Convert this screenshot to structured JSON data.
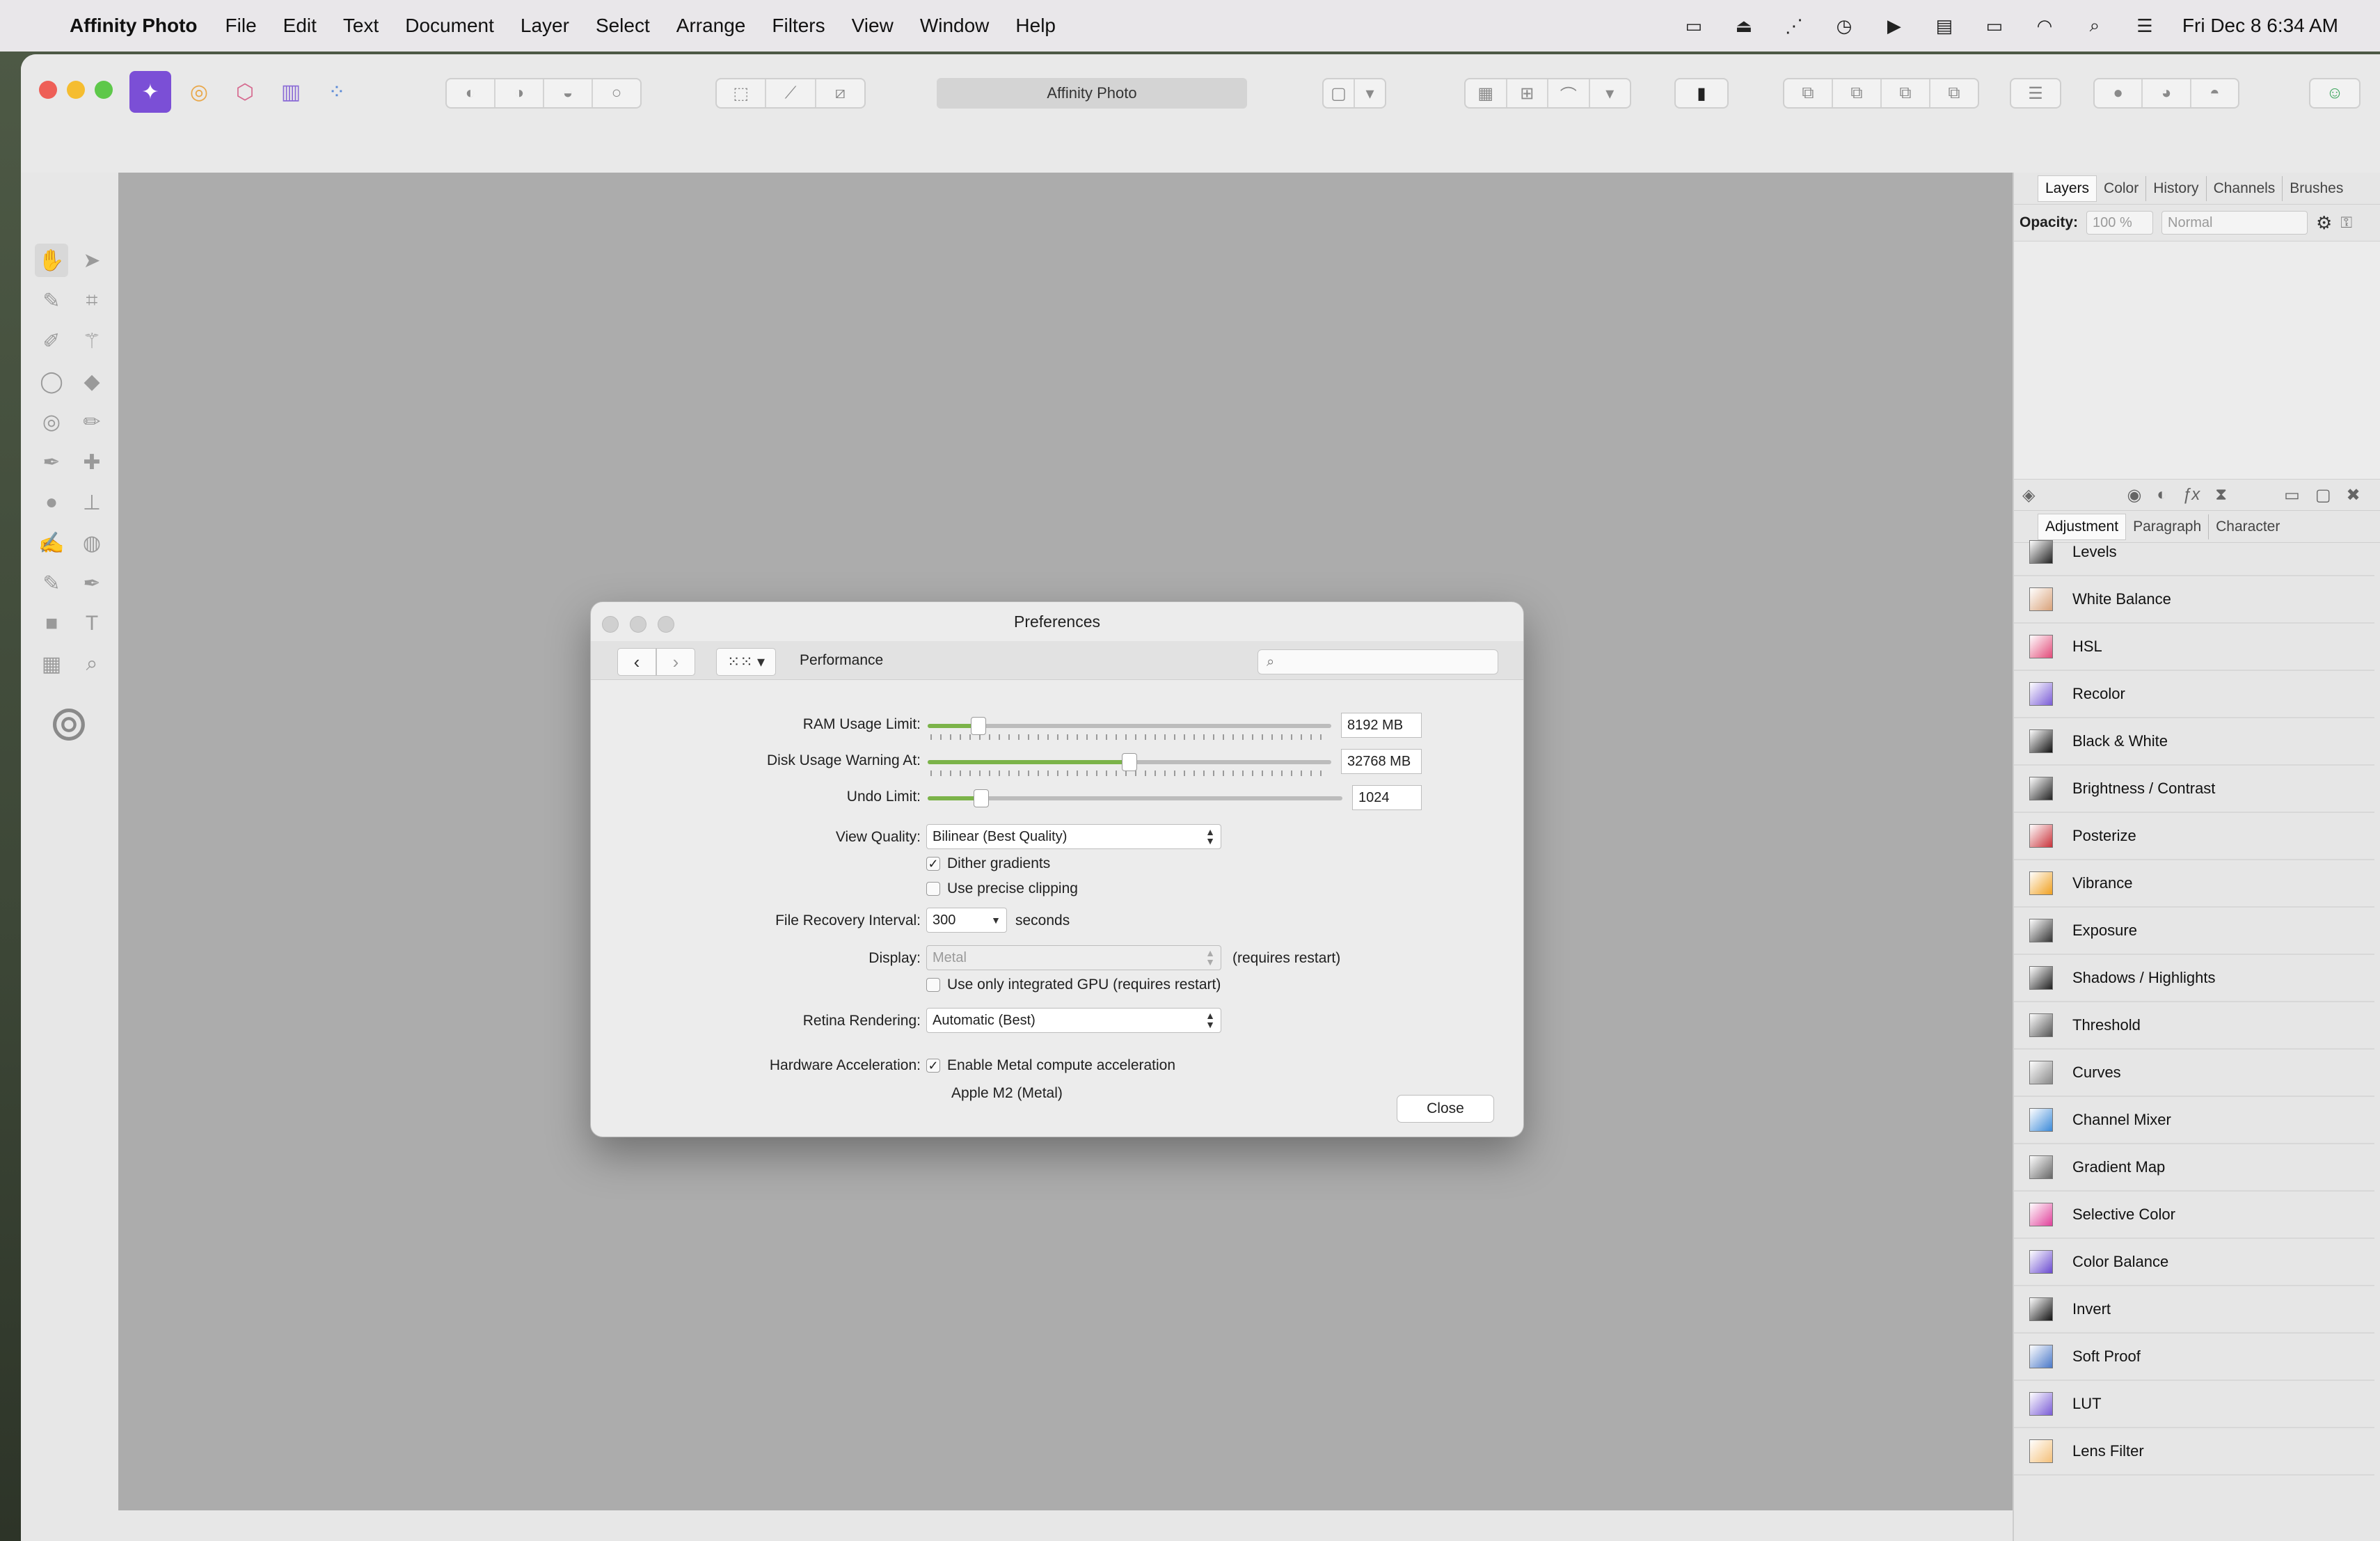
{
  "menubar": {
    "app_name": "Affinity Photo",
    "items": [
      "File",
      "Edit",
      "Text",
      "Document",
      "Layer",
      "Select",
      "Arrange",
      "Filters",
      "View",
      "Window",
      "Help"
    ],
    "clock": "Fri Dec 8  6:34 AM"
  },
  "toolbar": {
    "document_title": "Affinity Photo"
  },
  "panel": {
    "top_tabs": [
      "Layers",
      "Color",
      "History",
      "Channels",
      "Brushes"
    ],
    "opacity_label": "Opacity:",
    "opacity_value": "100 %",
    "blend_mode": "Normal",
    "bottom_tabs": [
      "Adjustment",
      "Paragraph",
      "Character"
    ],
    "adjustments": [
      {
        "label": "Levels",
        "icon": "levels-icon",
        "color": "#222222"
      },
      {
        "label": "White Balance",
        "icon": "white-balance-icon",
        "color": "#d9a27a"
      },
      {
        "label": "HSL",
        "icon": "hsl-icon",
        "color": "#e24b7a"
      },
      {
        "label": "Recolor",
        "icon": "recolor-icon",
        "color": "#7a5cd6"
      },
      {
        "label": "Black & White",
        "icon": "black-white-icon",
        "color": "#111111"
      },
      {
        "label": "Brightness / Contrast",
        "icon": "brightness-contrast-icon",
        "color": "#222222"
      },
      {
        "label": "Posterize",
        "icon": "posterize-icon",
        "color": "#c9323a"
      },
      {
        "label": "Vibrance",
        "icon": "vibrance-icon",
        "color": "#f0a020"
      },
      {
        "label": "Exposure",
        "icon": "exposure-icon",
        "color": "#333333"
      },
      {
        "label": "Shadows / Highlights",
        "icon": "shadows-highlights-icon",
        "color": "#1f1f1f"
      },
      {
        "label": "Threshold",
        "icon": "threshold-icon",
        "color": "#555555"
      },
      {
        "label": "Curves",
        "icon": "curves-icon",
        "color": "#888888"
      },
      {
        "label": "Channel Mixer",
        "icon": "channel-mixer-icon",
        "color": "#3b8ad9"
      },
      {
        "label": "Gradient Map",
        "icon": "gradient-map-icon",
        "color": "#666666"
      },
      {
        "label": "Selective Color",
        "icon": "selective-color-icon",
        "color": "#e0409a"
      },
      {
        "label": "Color Balance",
        "icon": "color-balance-icon",
        "color": "#6a4ad0"
      },
      {
        "label": "Invert",
        "icon": "invert-icon",
        "color": "#111111"
      },
      {
        "label": "Soft Proof",
        "icon": "soft-proof-icon",
        "color": "#4a78c8"
      },
      {
        "label": "LUT",
        "icon": "lut-icon",
        "color": "#7a5cd6"
      },
      {
        "label": "Lens Filter",
        "icon": "lens-filter-icon",
        "color": "#f4c07a"
      }
    ]
  },
  "dialog": {
    "title": "Preferences",
    "section": "Performance",
    "search_placeholder": "",
    "ram_label": "RAM Usage Limit:",
    "ram_value": "8192 MB",
    "ram_fraction": 0.125,
    "disk_label": "Disk Usage Warning At:",
    "disk_value": "32768 MB",
    "disk_fraction": 0.5,
    "undo_label": "Undo Limit:",
    "undo_value": "1024",
    "undo_fraction": 0.13,
    "view_quality_label": "View Quality:",
    "view_quality_value": "Bilinear (Best Quality)",
    "dither_label": "Dither gradients",
    "dither_checked": true,
    "precise_label": "Use precise clipping",
    "precise_checked": false,
    "recovery_label": "File Recovery Interval:",
    "recovery_value": "300",
    "recovery_unit": "seconds",
    "display_label": "Display:",
    "display_value": "Metal",
    "display_note": "(requires restart)",
    "gpu_label": "Use only integrated GPU (requires restart)",
    "gpu_checked": false,
    "retina_label": "Retina Rendering:",
    "retina_value": "Automatic (Best)",
    "hw_label": "Hardware Acceleration:",
    "metal_label": "Enable Metal compute acceleration",
    "metal_checked": true,
    "gpu_name": "Apple M2 (Metal)",
    "close_label": "Close"
  }
}
